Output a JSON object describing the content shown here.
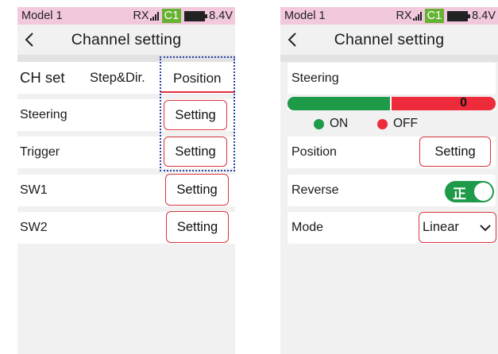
{
  "left_screen": {
    "status": {
      "model": "Model 1",
      "rx": "RX",
      "channel": "C1",
      "voltage": "8.4V"
    },
    "title": "Channel setting",
    "tabs": [
      {
        "label": "CH set"
      },
      {
        "label": "Step&Dir."
      },
      {
        "label": "Position",
        "active": true
      }
    ],
    "rows": [
      {
        "label": "Steering",
        "button": "Setting"
      },
      {
        "label": "Trigger",
        "button": "Setting"
      },
      {
        "label": "SW1",
        "button": "Setting"
      },
      {
        "label": "SW2",
        "button": "Setting"
      }
    ]
  },
  "right_screen": {
    "status": {
      "model": "Model 1",
      "rx": "RX",
      "channel": "C1",
      "voltage": "8.4V"
    },
    "title": "Channel setting",
    "channel_name": "Steering",
    "bar": {
      "value": "0",
      "on_label": "ON",
      "off_label": "OFF"
    },
    "position": {
      "label": "Position",
      "button": "Setting"
    },
    "reverse": {
      "label": "Reverse",
      "toggle_text": "正",
      "on": true
    },
    "mode": {
      "label": "Mode",
      "value": "Linear"
    }
  },
  "colors": {
    "status_bar": "#f2c8dc",
    "channel_badge": "#65b330",
    "accent_red": "#d9363e",
    "on_green": "#1e9a49",
    "off_red": "#ed2b3a",
    "dashed_highlight": "#2a3fa8"
  },
  "icons": [
    "back-chevron-icon",
    "signal-icon",
    "battery-icon",
    "dropdown-chevron-icon"
  ]
}
